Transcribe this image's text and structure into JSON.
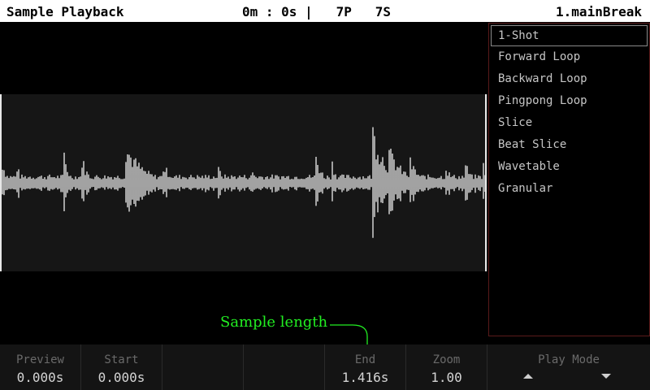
{
  "header": {
    "title": "Sample Playback",
    "status": "0m : 0s |   7P   7S",
    "sample_name": "1.mainBreak"
  },
  "play_modes": {
    "items": [
      "1-Shot",
      "Forward Loop",
      "Backward Loop",
      "Pingpong Loop",
      "Slice",
      "Beat Slice",
      "Wavetable",
      "Granular"
    ],
    "selected": "1-Shot"
  },
  "annotation": {
    "text": "Sample length",
    "color": "#22ee22"
  },
  "params": {
    "preview": {
      "label": "Preview",
      "value": "0.000s"
    },
    "start": {
      "label": "Start",
      "value": "0.000s"
    },
    "end": {
      "label": "End",
      "value": "1.416s"
    },
    "zoom": {
      "label": "Zoom",
      "value": "1.00"
    },
    "play_mode": {
      "label": "Play Mode"
    }
  },
  "colors": {
    "accent_annotation": "#22ee22",
    "waveform": "#ffffff",
    "header_bg": "#ffffff",
    "panel_border": "#5a1a1a"
  }
}
